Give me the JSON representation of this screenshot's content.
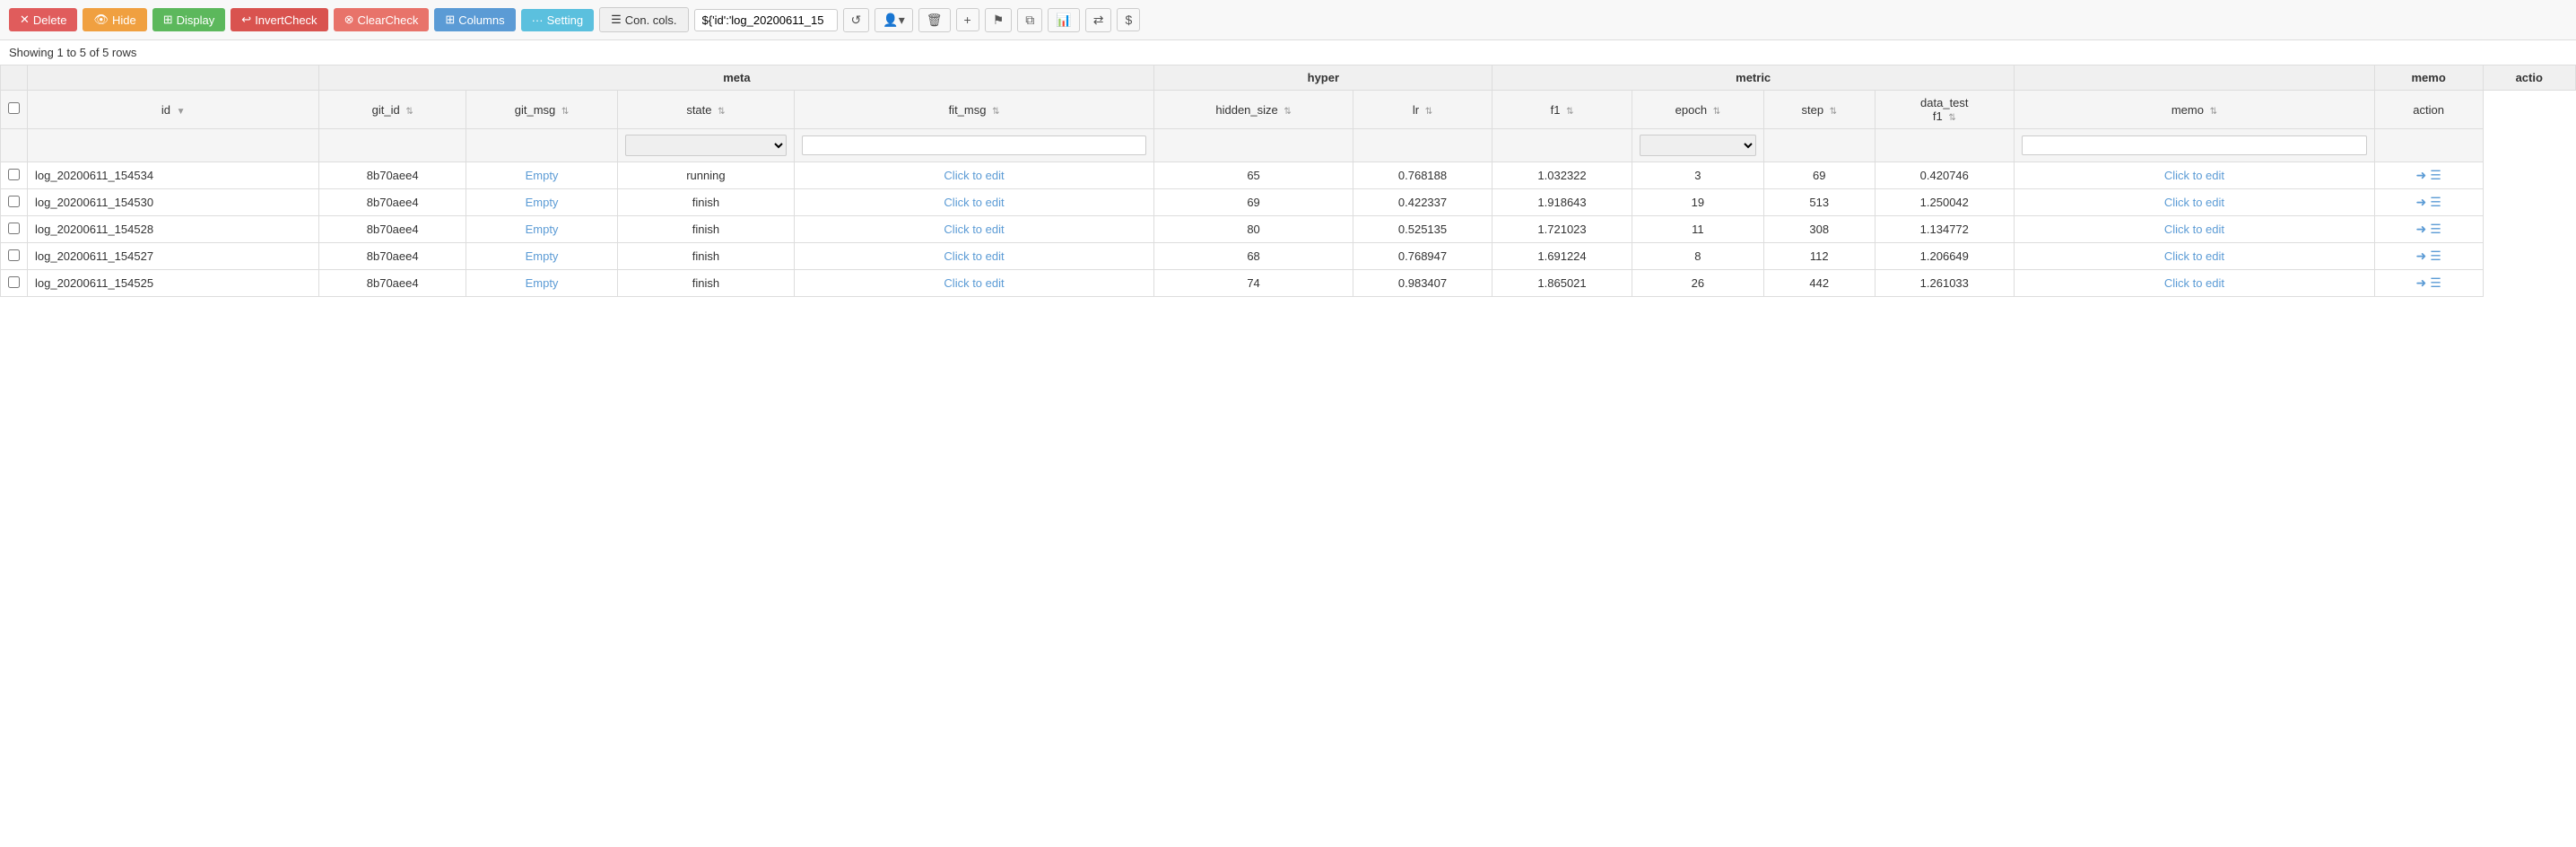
{
  "toolbar": {
    "delete_label": "Delete",
    "hide_label": "Hide",
    "display_label": "Display",
    "invertcheck_label": "InvertCheck",
    "clearcheck_label": "ClearCheck",
    "columns_label": "Columns",
    "setting_label": "Setting",
    "concols_label": "Con. cols.",
    "query_value": "${'id':'log_20200611_15",
    "refresh_icon": "↺",
    "user_icon": "👤",
    "trash_icon": "🗑",
    "plus_icon": "+",
    "flag_icon": "⚑",
    "copy_icon": "⧉",
    "chart_icon": "📊",
    "swap_icon": "⇄",
    "dollar_icon": "$"
  },
  "row_count": "Showing 1 to 5 of 5 rows",
  "table": {
    "group_headers": [
      {
        "label": "",
        "colspan": 2
      },
      {
        "label": "meta",
        "colspan": 4
      },
      {
        "label": "hyper",
        "colspan": 2
      },
      {
        "label": "metric",
        "colspan": 4
      },
      {
        "label": "",
        "colspan": 1
      },
      {
        "label": "memo",
        "colspan": 1
      },
      {
        "label": "actio",
        "colspan": 1
      }
    ],
    "columns": [
      {
        "key": "checkbox",
        "label": ""
      },
      {
        "key": "id",
        "label": "id",
        "sortable": true
      },
      {
        "key": "git_id",
        "label": "git_id",
        "sortable": true
      },
      {
        "key": "git_msg",
        "label": "git_msg",
        "sortable": true
      },
      {
        "key": "state",
        "label": "state",
        "sortable": true,
        "filter": "select"
      },
      {
        "key": "fit_msg",
        "label": "fit_msg",
        "sortable": true,
        "filter": "input"
      },
      {
        "key": "hidden_size",
        "label": "hidden_size",
        "sortable": true
      },
      {
        "key": "lr",
        "label": "lr",
        "sortable": true
      },
      {
        "key": "f1",
        "label": "f1",
        "sortable": true
      },
      {
        "key": "epoch",
        "label": "epoch",
        "sortable": true,
        "filter": "select"
      },
      {
        "key": "step",
        "label": "step",
        "sortable": true
      },
      {
        "key": "data_test_f1",
        "label": "data_test\nf1",
        "sortable": true
      },
      {
        "key": "memo",
        "label": "memo",
        "sortable": true,
        "filter": "input"
      },
      {
        "key": "action",
        "label": "action"
      }
    ],
    "rows": [
      {
        "id": "log_20200611_154534",
        "git_id": "8b70aee4",
        "git_msg": "Empty",
        "state": "running",
        "fit_msg": "Click to edit",
        "hidden_size": "65",
        "lr": "0.768188",
        "f1": "1.032322",
        "epoch": "3",
        "step": "69",
        "data_test_f1": "0.420746",
        "memo": "Click to edit"
      },
      {
        "id": "log_20200611_154530",
        "git_id": "8b70aee4",
        "git_msg": "Empty",
        "state": "finish",
        "fit_msg": "Click to edit",
        "hidden_size": "69",
        "lr": "0.422337",
        "f1": "1.918643",
        "epoch": "19",
        "step": "513",
        "data_test_f1": "1.250042",
        "memo": "Click to edit"
      },
      {
        "id": "log_20200611_154528",
        "git_id": "8b70aee4",
        "git_msg": "Empty",
        "state": "finish",
        "fit_msg": "Click to edit",
        "hidden_size": "80",
        "lr": "0.525135",
        "f1": "1.721023",
        "epoch": "11",
        "step": "308",
        "data_test_f1": "1.134772",
        "memo": "Click to edit"
      },
      {
        "id": "log_20200611_154527",
        "git_id": "8b70aee4",
        "git_msg": "Empty",
        "state": "finish",
        "fit_msg": "Click to edit",
        "hidden_size": "68",
        "lr": "0.768947",
        "f1": "1.691224",
        "epoch": "8",
        "step": "112",
        "data_test_f1": "1.206649",
        "memo": "Click to edit"
      },
      {
        "id": "log_20200611_154525",
        "git_id": "8b70aee4",
        "git_msg": "Empty",
        "state": "finish",
        "fit_msg": "Click to edit",
        "hidden_size": "74",
        "lr": "0.983407",
        "f1": "1.865021",
        "epoch": "26",
        "step": "442",
        "data_test_f1": "1.261033",
        "memo": "Click to edit"
      }
    ]
  }
}
